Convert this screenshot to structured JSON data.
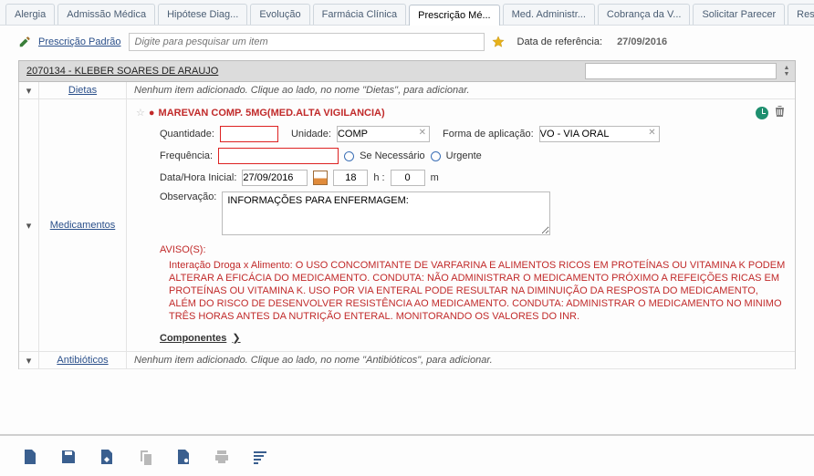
{
  "tabs": [
    {
      "label": "Alergia"
    },
    {
      "label": "Admissão Médica"
    },
    {
      "label": "Hipótese Diag..."
    },
    {
      "label": "Evolução"
    },
    {
      "label": "Farmácia Clínica"
    },
    {
      "label": "Prescrição Mé...",
      "active": true
    },
    {
      "label": "Med. Administr..."
    },
    {
      "label": "Cobrança da V..."
    },
    {
      "label": "Solicitar Parecer"
    },
    {
      "label": "Res"
    }
  ],
  "search": {
    "std_label": "Prescrição Padrão",
    "placeholder": "Digite para pesquisar um item",
    "ref_label": "Data de referência:",
    "ref_date": "27/09/2016"
  },
  "patient": {
    "id_name": "2070134 - KLEBER SOARES DE ARAUJO"
  },
  "sections": {
    "dietas": {
      "label": "Dietas",
      "hint": "Nenhum item adicionado. Clique ao lado, no nome \"Dietas\", para adicionar."
    },
    "medicamentos": {
      "label": "Medicamentos"
    },
    "antibioticos": {
      "label": "Antibióticos",
      "hint": "Nenhum item adicionado. Clique ao lado, no nome \"Antibióticos\", para adicionar."
    }
  },
  "med": {
    "title": "MAREVAN COMP. 5MG(MED.ALTA VIGILANCIA)",
    "qty_label": "Quantidade:",
    "unit_label": "Unidade:",
    "unit_value": "COMP",
    "route_label": "Forma de aplicação:",
    "route_value": "VO - VIA ORAL",
    "freq_label": "Frequência:",
    "senec": "Se Necessário",
    "urg": "Urgente",
    "dt_label": "Data/Hora Inicial:",
    "dt_date": "27/09/2016",
    "dt_h": "18",
    "dt_h_suffix": "h :",
    "dt_m": "0",
    "dt_m_suffix": "m",
    "obs_label": "Observação:",
    "obs_value": "INFORMAÇÕES PARA ENFERMAGEM:",
    "avisos_h": "AVISO(S):",
    "avisos_t": "Interação Droga x Alimento: O USO CONCOMITANTE DE VARFARINA E ALIMENTOS RICOS EM PROTEÍNAS OU VITAMINA K PODEM ALTERAR A EFICÁCIA DO MEDICAMENTO. CONDUTA:  NÃO ADMINISTRAR O MEDICAMENTO PRÓXIMO A REFEIÇÕES RICAS EM PROTEÍNAS OU VITAMINA K. USO POR VIA ENTERAL PODE RESULTAR NA DIMINUIÇÃO DA RESPOSTA DO MEDICAMENTO, ALÉM DO RISCO DE DESENVOLVER RESISTÊNCIA AO MEDICAMENTO. CONDUTA: ADMINISTRAR O MEDICAMENTO NO MINIMO TRÊS HORAS ANTES DA NUTRIÇÃO ENTERAL. MONITORANDO OS VALORES DO INR.",
    "componentes": "Componentes"
  }
}
